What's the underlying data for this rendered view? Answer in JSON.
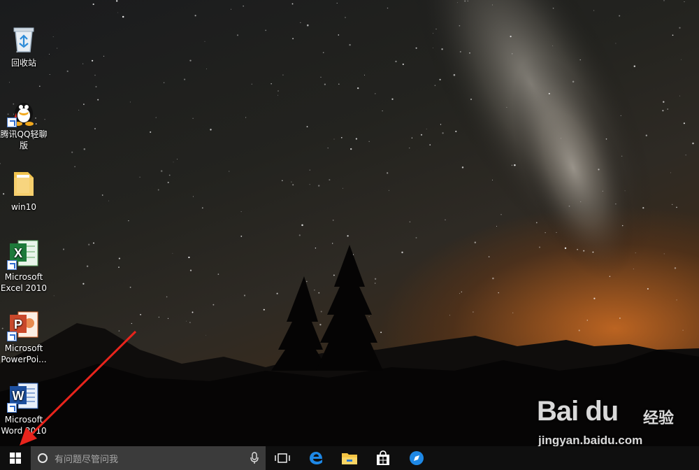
{
  "desktop": {
    "icons": [
      {
        "label": "回收站",
        "icon": "recycle-bin-icon"
      },
      {
        "label": "腾讯QQ轻聊版",
        "icon": "qq-icon"
      },
      {
        "label": "win10",
        "icon": "folder-icon"
      },
      {
        "label": "Microsoft Excel 2010",
        "icon": "excel-icon"
      },
      {
        "label": "Microsoft PowerPoi...",
        "icon": "powerpoint-icon"
      },
      {
        "label": "Microsoft Word 2010",
        "icon": "word-icon"
      }
    ]
  },
  "taskbar": {
    "search_placeholder": "有问题尽管问我",
    "apps": [
      "task-view-icon",
      "edge-icon",
      "file-explorer-icon",
      "store-icon",
      "maps-icon"
    ]
  },
  "watermark": {
    "brand": "Bai du",
    "brand_cn": "经验",
    "url": "jingyan.baidu.com"
  },
  "colors": {
    "accent_orange": "#d9722a",
    "taskbar": "#101010",
    "search_box": "#3b3b3b",
    "annotation_arrow": "#e8241c",
    "edge_blue": "#1e88e5"
  }
}
